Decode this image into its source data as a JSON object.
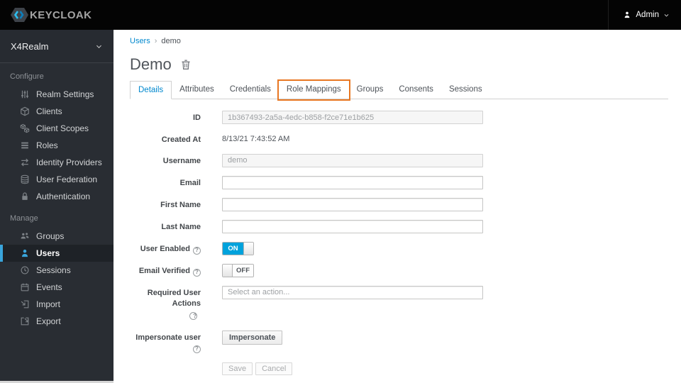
{
  "topbar": {
    "brand": "KEYCLOAK",
    "user_menu": {
      "label": "Admin"
    }
  },
  "sidebar": {
    "realm_selector": {
      "label": "X4Realm"
    },
    "sections": [
      {
        "heading": "Configure",
        "items": [
          {
            "label": "Realm Settings",
            "icon": "sliders-icon"
          },
          {
            "label": "Clients",
            "icon": "cube-icon"
          },
          {
            "label": "Client Scopes",
            "icon": "cubes-icon"
          },
          {
            "label": "Roles",
            "icon": "list-icon"
          },
          {
            "label": "Identity Providers",
            "icon": "exchange-arrows-icon"
          },
          {
            "label": "User Federation",
            "icon": "database-icon"
          },
          {
            "label": "Authentication",
            "icon": "lock-icon"
          }
        ]
      },
      {
        "heading": "Manage",
        "items": [
          {
            "label": "Groups",
            "icon": "group-icon"
          },
          {
            "label": "Users",
            "icon": "user-icon",
            "active": true
          },
          {
            "label": "Sessions",
            "icon": "clock-icon"
          },
          {
            "label": "Events",
            "icon": "calendar-icon"
          },
          {
            "label": "Import",
            "icon": "import-icon"
          },
          {
            "label": "Export",
            "icon": "export-icon"
          }
        ]
      }
    ]
  },
  "breadcrumb": {
    "parent": "Users",
    "separator": "›",
    "current": "demo"
  },
  "page": {
    "title": "Demo"
  },
  "tabs": {
    "items": [
      {
        "label": "Details",
        "active": true
      },
      {
        "label": "Attributes"
      },
      {
        "label": "Credentials"
      },
      {
        "label": "Role Mappings",
        "highlighted": true
      },
      {
        "label": "Groups"
      },
      {
        "label": "Consents"
      },
      {
        "label": "Sessions"
      }
    ]
  },
  "form": {
    "id": {
      "label": "ID",
      "value": "1b367493-2a5a-4edc-b858-f2ce71e1b625"
    },
    "created_at": {
      "label": "Created At",
      "value": "8/13/21 7:43:52 AM"
    },
    "username": {
      "label": "Username",
      "value": "demo"
    },
    "email": {
      "label": "Email",
      "value": ""
    },
    "first_name": {
      "label": "First Name",
      "value": ""
    },
    "last_name": {
      "label": "Last Name",
      "value": ""
    },
    "user_enabled": {
      "label": "User Enabled",
      "state": "ON"
    },
    "email_verified": {
      "label": "Email Verified",
      "state": "OFF"
    },
    "required_user_actions": {
      "label": "Required User Actions",
      "placeholder": "Select an action..."
    },
    "impersonate": {
      "label": "Impersonate user",
      "button": "Impersonate"
    },
    "actions": {
      "save": "Save",
      "cancel": "Cancel"
    }
  },
  "colors": {
    "accent_blue": "#0088ce",
    "toggle_on_blue": "#00a2dc",
    "active_nav_blue": "#39a5dc",
    "highlight_orange": "#e87722",
    "topbar_black": "#040404",
    "sidebar_dark": "#292d33"
  }
}
